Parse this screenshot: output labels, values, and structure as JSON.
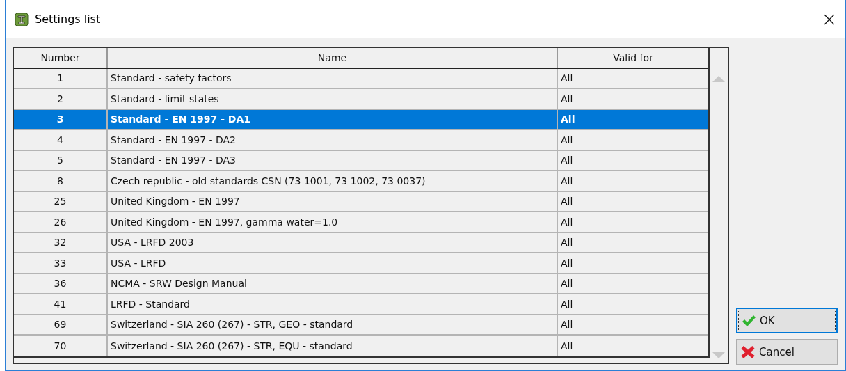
{
  "window": {
    "title": "Settings list",
    "close": "×"
  },
  "table": {
    "columns": [
      "Number",
      "Name",
      "Valid for"
    ],
    "rows": [
      {
        "number": "1",
        "name": "Standard - safety factors",
        "valid_for": "All",
        "selected": false
      },
      {
        "number": "2",
        "name": "Standard - limit states",
        "valid_for": "All",
        "selected": false
      },
      {
        "number": "3",
        "name": "Standard - EN 1997 - DA1",
        "valid_for": "All",
        "selected": true
      },
      {
        "number": "4",
        "name": "Standard - EN 1997 - DA2",
        "valid_for": "All",
        "selected": false
      },
      {
        "number": "5",
        "name": "Standard - EN 1997 - DA3",
        "valid_for": "All",
        "selected": false
      },
      {
        "number": "8",
        "name": "Czech republic - old standards CSN (73 1001, 73 1002, 73 0037)",
        "valid_for": "All",
        "selected": false
      },
      {
        "number": "25",
        "name": "United Kingdom - EN 1997",
        "valid_for": "All",
        "selected": false
      },
      {
        "number": "26",
        "name": "United Kingdom - EN 1997, gamma water=1.0",
        "valid_for": "All",
        "selected": false
      },
      {
        "number": "32",
        "name": "USA - LRFD 2003",
        "valid_for": "All",
        "selected": false
      },
      {
        "number": "33",
        "name": "USA - LRFD",
        "valid_for": "All",
        "selected": false
      },
      {
        "number": "36",
        "name": "NCMA - SRW Design Manual",
        "valid_for": "All",
        "selected": false
      },
      {
        "number": "41",
        "name": "LRFD - Standard",
        "valid_for": "All",
        "selected": false
      },
      {
        "number": "69",
        "name": "Switzerland - SIA 260 (267) - STR, GEO - standard",
        "valid_for": "All",
        "selected": false
      },
      {
        "number": "70",
        "name": "Switzerland - SIA 260 (267) - STR, EQU - standard",
        "valid_for": "All",
        "selected": false
      }
    ]
  },
  "buttons": [
    {
      "label": "OK",
      "kind": "ok",
      "focused": true
    },
    {
      "label": "Cancel",
      "kind": "cancel",
      "focused": false
    }
  ]
}
